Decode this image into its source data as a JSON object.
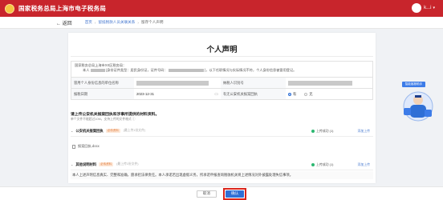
{
  "header": {
    "site_title": "国家税务总局上海市电子税务局",
    "user_name": "k...i"
  },
  "breadcrumb": {
    "back_label": "返回",
    "items": [
      "首页",
      "留抵税款人员关联关系",
      "留存个人声明"
    ]
  },
  "page": {
    "title": "个人声明",
    "notice_line1": "国家税务总局上海市XX区税务局：",
    "notice_line2_a": "本人",
    "notice_line2_b": "(身份证件类型：居民身份证，证件号码：",
    "notice_line2_c": ")，以下任职情况与实际情况不符，个人身份信息被冒用登记。"
  },
  "form": {
    "row1": {
      "label_left": "冒用个人身份信息的单位名称",
      "label_right": "纳税人识别号"
    },
    "row2": {
      "label_left": "报税日期",
      "date_value": "2023-12-31",
      "label_right": "有无公安机关报案回执",
      "option_yes": "有",
      "option_no": "无",
      "selected": "有"
    }
  },
  "attachments": {
    "heading": "请上传公安机关报案回执和涉事所提供的材料资料。",
    "subheading": "单个文件不能超过10M，支持上传的文件格式 ⓘ",
    "items": [
      {
        "name": "公安机关报案回执",
        "tag": "必传资料",
        "hint": "(最上传1份文件)",
        "status": "上传成功 (1)",
        "add_label": "添加上传"
      },
      {
        "name": "其他说明材料",
        "tag": "必传资料",
        "hint": "(最上传1份文件)",
        "status": "上传成功 (1)",
        "add_label": "添加上传"
      }
    ],
    "doc_name": "报案回执.docx"
  },
  "declaration": "本人上述声明信息真实、完整和准确，愿承担法律责任。本人承诺若出现虚假义务，所承诺申报查询税收机关将上述情况对外披露处理失信事项。",
  "service_label": "智能客服助手",
  "footer": {
    "cancel_label": "取消",
    "confirm_label": "确认"
  }
}
